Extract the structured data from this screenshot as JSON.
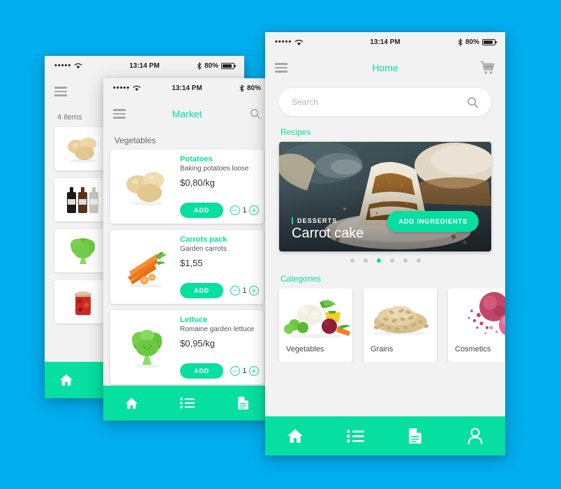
{
  "canvas": {
    "background_color": "#00AEEF",
    "accent_color": "#06DFA0"
  },
  "status_bar": {
    "signal": "•••••",
    "wifi_icon": "wifi-icon",
    "time": "13:14 PM",
    "bluetooth_icon": "bluetooth-icon",
    "battery_percent": "80%",
    "battery_icon": "battery-icon"
  },
  "phone_cart": {
    "menu_icon": "hamburger-menu-icon",
    "item_count": "4 items",
    "items": [
      {
        "name": "potatoes",
        "thumb": "potatoes-thumbnail"
      },
      {
        "name": "bottles",
        "thumb": "bottles-thumbnail"
      },
      {
        "name": "lettuce",
        "thumb": "lettuce-thumbnail"
      },
      {
        "name": "preserves-jar",
        "thumb": "preserves-jar-thumbnail"
      }
    ],
    "checkout_label": "",
    "nav": [
      {
        "icon": "home-icon",
        "active": true
      }
    ]
  },
  "phone_market": {
    "menu_icon": "hamburger-menu-icon",
    "title": "Market",
    "search_icon": "search-icon",
    "section_label": "Vegetables",
    "products": [
      {
        "name": "Potatoes",
        "description": "Baking potatoes loose",
        "price": "$0,80/kg",
        "add_label": "ADD",
        "quantity": "1",
        "image": "potatoes-image"
      },
      {
        "name": "Carrots pack",
        "description": "Garden carrots",
        "price": "$1,55",
        "add_label": "ADD",
        "quantity": "1",
        "image": "carrots-image"
      },
      {
        "name": "Lettuce",
        "description": "Romaine garden lettuce",
        "price": "$0,95/kg",
        "add_label": "ADD",
        "quantity": "1",
        "image": "lettuce-image"
      }
    ],
    "nav": [
      {
        "icon": "home-icon"
      },
      {
        "icon": "list-icon"
      },
      {
        "icon": "document-icon"
      }
    ]
  },
  "phone_home": {
    "menu_icon": "hamburger-menu-icon",
    "title": "Home",
    "cart_icon": "shopping-cart-icon",
    "search": {
      "placeholder": "Search",
      "value": "",
      "icon": "search-icon"
    },
    "recipes_title": "Recipes",
    "recipe": {
      "category": "DESSERTS",
      "title": "Carrot cake",
      "button_label": "ADD INGREDIENTS",
      "image": "carrot-cake-photo"
    },
    "carousel": {
      "total": 6,
      "active_index": 2
    },
    "categories_title": "Categories",
    "categories": [
      {
        "label": "Vegetables",
        "image": "vegetables-image"
      },
      {
        "label": "Grains",
        "image": "grains-image"
      },
      {
        "label": "Cosmetics",
        "image": "cosmetics-image"
      }
    ],
    "nav": [
      {
        "icon": "home-icon"
      },
      {
        "icon": "list-icon"
      },
      {
        "icon": "document-icon"
      },
      {
        "icon": "person-icon"
      }
    ]
  }
}
